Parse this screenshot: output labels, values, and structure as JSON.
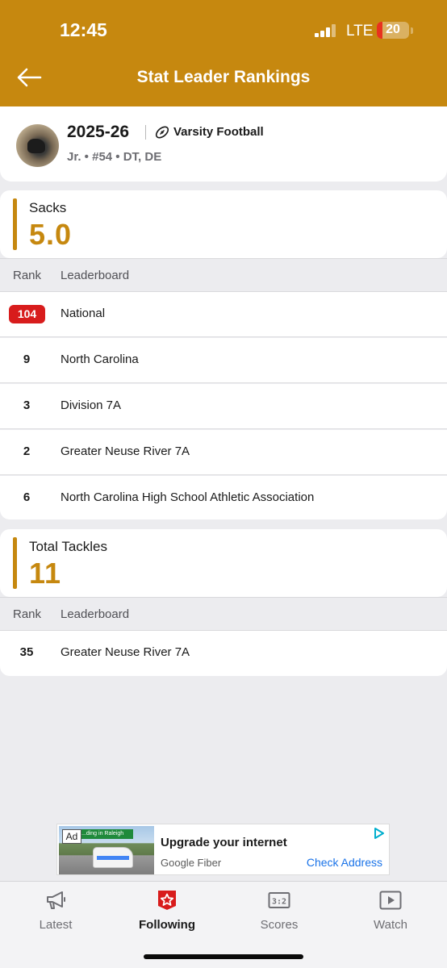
{
  "status_bar": {
    "time": "12:45",
    "network": "LTE",
    "battery": "20",
    "battery_color": "#e8321e"
  },
  "header": {
    "title": "Stat Leader Rankings",
    "back_icon": "arrow-left-icon",
    "background": "#c6880f"
  },
  "player": {
    "season": "2025-26",
    "sport_icon": "football-icon",
    "sport": "Varsity Football",
    "meta": "Jr. • #54 • DT, DE"
  },
  "sacks": {
    "label": "Sacks",
    "value": "5.0",
    "columns": {
      "rank": "Rank",
      "leaderboard": "Leaderboard"
    },
    "rows": [
      {
        "rank": "104",
        "leaderboard": "National",
        "highlight": true
      },
      {
        "rank": "9",
        "leaderboard": "North Carolina"
      },
      {
        "rank": "3",
        "leaderboard": "Division 7A"
      },
      {
        "rank": "2",
        "leaderboard": "Greater Neuse River 7A"
      },
      {
        "rank": "6",
        "leaderboard": "North Carolina High School Athletic Association"
      }
    ]
  },
  "tackles": {
    "label": "Total Tackles",
    "value": "11",
    "columns": {
      "rank": "Rank",
      "leaderboard": "Leaderboard"
    },
    "rows": [
      {
        "rank": "35",
        "leaderboard": "Greater Neuse River 7A"
      }
    ]
  },
  "ad": {
    "tag": "Ad",
    "title": "Upgrade your internet",
    "brand": "Google Fiber",
    "cta": "Check Address",
    "image_caption": "...ding in Raleigh",
    "choices_icon": "adchoices-icon"
  },
  "tabs": [
    {
      "label": "Latest",
      "icon": "megaphone-icon"
    },
    {
      "label": "Following",
      "icon": "star-badge-icon",
      "active": true
    },
    {
      "label": "Scores",
      "icon": "scoreboard-icon"
    },
    {
      "label": "Watch",
      "icon": "play-icon"
    }
  ]
}
